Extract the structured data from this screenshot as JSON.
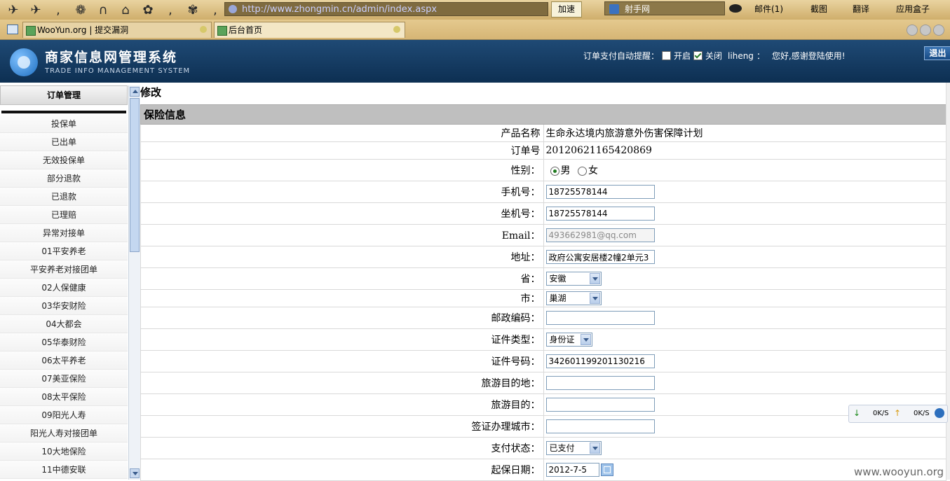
{
  "browser": {
    "address_url": "http://www.zhongmin.cn/admin/index.aspx",
    "speed_label": "加速",
    "search_label": "射手网",
    "mail_label": "邮件(1)",
    "screenshot_label": "截图",
    "translate_label": "翻译",
    "appbox_label": "应用盒子",
    "tabs": [
      {
        "label": "WooYun.org | 提交漏洞"
      },
      {
        "label": "后台首页"
      }
    ]
  },
  "header": {
    "title": "商家信息网管理系统",
    "subtitle": "TRADE INFO MANAGEMENT SYSTEM",
    "reminder_label": "订单支付自动提醒：",
    "option_on": "开启",
    "option_off": "关闭",
    "username": "liheng",
    "greeting": "您好,感谢登陆使用!",
    "logout_label": "退出"
  },
  "sidebar": {
    "title": "订单管理",
    "items": [
      "投保单",
      "已出单",
      "无效投保单",
      "部分退款",
      "已退款",
      "已理赔",
      "异常对接单",
      "01平安养老",
      "平安养老对接团单",
      "02人保健康",
      "03华安财险",
      "04大都会",
      "05华泰财险",
      "06太平养老",
      "07美亚保险",
      "08太平保险",
      "09阳光人寿",
      "阳光人寿对接团单",
      "10大地保险",
      "11中德安联"
    ]
  },
  "main": {
    "page_title": "修改",
    "section_title": "保险信息",
    "fields": {
      "product_name": {
        "label": "产品名称",
        "value": "生命永达境内旅游意外伤害保障计划"
      },
      "order_no": {
        "label": "订单号",
        "value": "20120621165420869"
      },
      "gender": {
        "label": "性别：",
        "male": "男",
        "female": "女"
      },
      "mobile": {
        "label": "手机号：",
        "value": "18725578144"
      },
      "landline": {
        "label": "坐机号：",
        "value": "18725578144"
      },
      "email": {
        "label": "Email：",
        "value": "493662981@qq.com"
      },
      "address": {
        "label": "地址：",
        "value": "政府公寓安居楼2幢2单元3"
      },
      "province": {
        "label": "省：",
        "value": "安徽"
      },
      "city": {
        "label": "市：",
        "value": "巢湖"
      },
      "postcode": {
        "label": "邮政编码：",
        "value": ""
      },
      "id_type": {
        "label": "证件类型：",
        "value": "身份证"
      },
      "id_number": {
        "label": "证件号码：",
        "value": "342601199201130216"
      },
      "destination": {
        "label": "旅游目的地：",
        "value": ""
      },
      "purpose": {
        "label": "旅游目的：",
        "value": ""
      },
      "visa_city": {
        "label": "签证办理城市：",
        "value": ""
      },
      "pay_status": {
        "label": "支付状态：",
        "value": "已支付"
      },
      "start_date": {
        "label": "起保日期：",
        "value": "2012-7-5"
      }
    }
  },
  "speed_widget": {
    "down": "0K/S",
    "up": "0K/S"
  },
  "watermark": "www.wooyun.org",
  "colors": {
    "header_bg": "#0d2f52",
    "section_bg": "#bfbfbf"
  }
}
